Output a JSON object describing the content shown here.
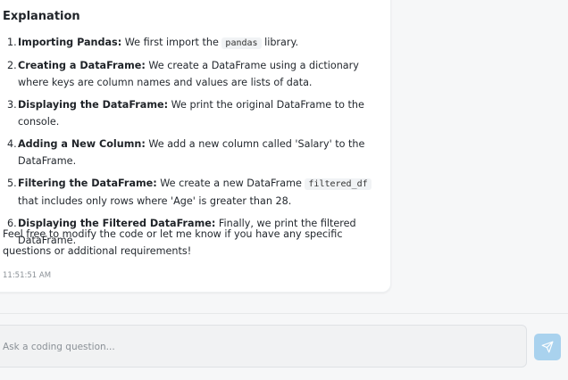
{
  "message": {
    "heading": "Explanation",
    "steps": [
      {
        "num": "1.",
        "title": "Importing Pandas:",
        "text1": " We first import the ",
        "code": "pandas",
        "text2": " library."
      },
      {
        "num": "2.",
        "title": "Creating a DataFrame:",
        "text": " We create a DataFrame using a dictionary where keys are column names and values are lists of data."
      },
      {
        "num": "3.",
        "title": "Displaying the DataFrame:",
        "text": " We print the original DataFrame to the console."
      },
      {
        "num": "4.",
        "title": "Adding a New Column:",
        "text": " We add a new column called 'Salary' to the DataFrame."
      },
      {
        "num": "5.",
        "title": "Filtering the DataFrame:",
        "text1": " We create a new DataFrame ",
        "code": "filtered_df",
        "text2": " that includes only rows where 'Age' is greater than 28."
      },
      {
        "num": "6.",
        "title": "Displaying the Filtered DataFrame:",
        "text": " Finally, we print the filtered DataFrame."
      }
    ],
    "closing": "Feel free to modify the code or let me know if you have any specific questions or additional requirements!",
    "timestamp": "11:51:51 AM"
  },
  "composer": {
    "placeholder": "Ask a coding question...",
    "value": "",
    "send_icon": "send-icon",
    "send_color": "#a9d2ee"
  }
}
